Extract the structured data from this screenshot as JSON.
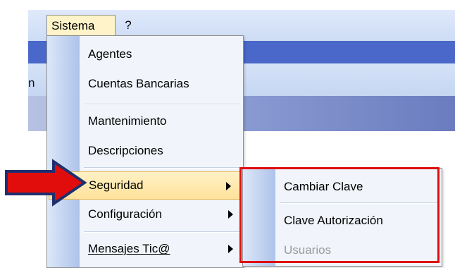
{
  "menubar": {
    "sistema": "Sistema",
    "help": "?"
  },
  "toolbar": {
    "fragment": "n"
  },
  "sistema_menu": {
    "items": [
      {
        "label": "Agentes"
      },
      {
        "label": "Cuentas Bancarias"
      },
      {
        "label": "Mantenimiento"
      },
      {
        "label": "Descripciones"
      },
      {
        "label": "Seguridad",
        "submenu": true,
        "highlighted": true
      },
      {
        "label": "Configuración",
        "submenu": true
      },
      {
        "label": "Mensajes Tic@",
        "submenu": true
      }
    ]
  },
  "seguridad_submenu": {
    "items": [
      {
        "label": "Cambiar Clave"
      },
      {
        "label": "Clave Autorización"
      },
      {
        "label": "Usuarios",
        "disabled": true
      }
    ]
  },
  "annotations": {
    "arrow_color": "#e10d0d",
    "box_color": "#e10d0d"
  }
}
